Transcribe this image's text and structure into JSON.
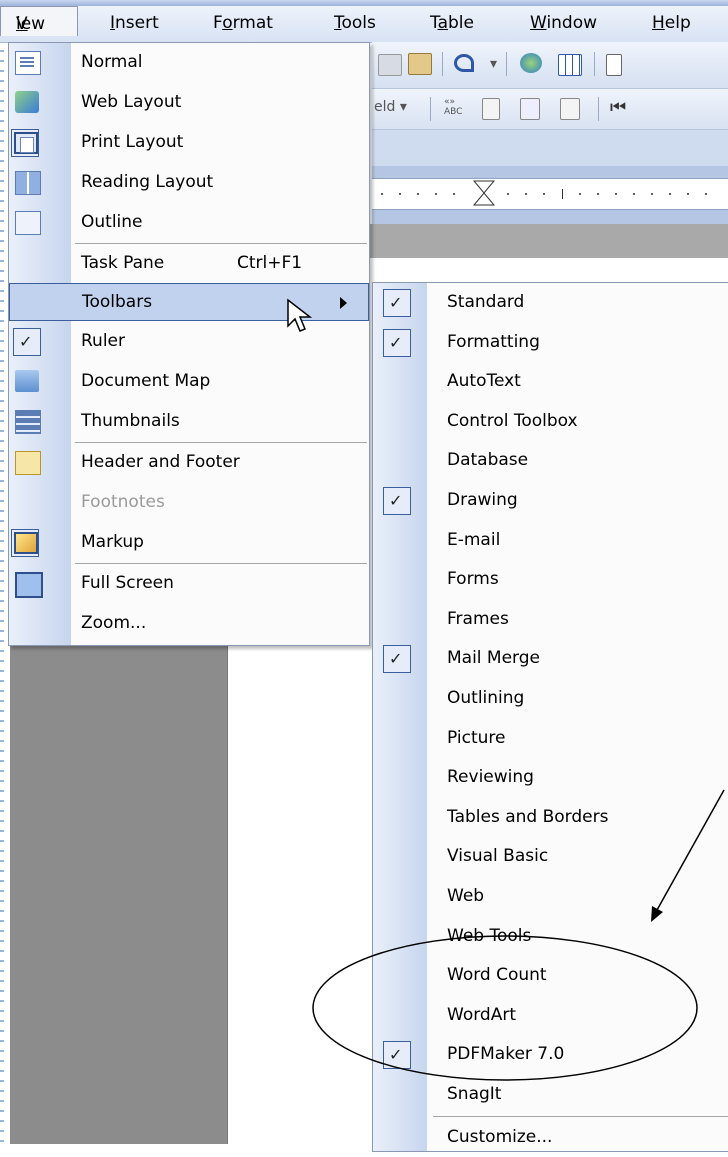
{
  "menubar": {
    "items": [
      "View",
      "Insert",
      "Format",
      "Tools",
      "Table",
      "Window",
      "Help"
    ]
  },
  "toolbar": {
    "field_dropdown": "eld",
    "abc_label": "ABC"
  },
  "view_menu": {
    "items": [
      {
        "label": "Normal",
        "icon": "normal-view-icon"
      },
      {
        "label": "Web Layout",
        "icon": "web-layout-icon"
      },
      {
        "label": "Print Layout",
        "icon": "print-layout-icon",
        "checked": true
      },
      {
        "label": "Reading Layout",
        "icon": "reading-layout-icon"
      },
      {
        "label": "Outline",
        "icon": "outline-icon"
      },
      {
        "label": "Task Pane",
        "shortcut": "Ctrl+F1"
      },
      {
        "label": "Toolbars",
        "submenu": true,
        "highlighted": true
      },
      {
        "label": "Ruler",
        "checked": true
      },
      {
        "label": "Document Map",
        "icon": "document-map-icon"
      },
      {
        "label": "Thumbnails",
        "icon": "thumbnails-icon"
      },
      {
        "label": "Header and Footer",
        "icon": "header-footer-icon"
      },
      {
        "label": "Footnotes",
        "disabled": true
      },
      {
        "label": "Markup",
        "icon": "markup-icon",
        "checked": true
      },
      {
        "label": "Full Screen",
        "icon": "full-screen-icon"
      },
      {
        "label": "Zoom..."
      }
    ]
  },
  "toolbars_menu": {
    "items": [
      {
        "label": "Standard",
        "checked": true
      },
      {
        "label": "Formatting",
        "checked": true
      },
      {
        "label": "AutoText",
        "checked": false
      },
      {
        "label": "Control Toolbox",
        "checked": false
      },
      {
        "label": "Database",
        "checked": false
      },
      {
        "label": "Drawing",
        "checked": true
      },
      {
        "label": "E-mail",
        "checked": false
      },
      {
        "label": "Forms",
        "checked": false
      },
      {
        "label": "Frames",
        "checked": false
      },
      {
        "label": "Mail Merge",
        "checked": true
      },
      {
        "label": "Outlining",
        "checked": false
      },
      {
        "label": "Picture",
        "checked": false
      },
      {
        "label": "Reviewing",
        "checked": false
      },
      {
        "label": "Tables and Borders",
        "checked": false
      },
      {
        "label": "Visual Basic",
        "checked": false
      },
      {
        "label": "Web",
        "checked": false
      },
      {
        "label": "Web Tools",
        "checked": false
      },
      {
        "label": "Word Count",
        "checked": false
      },
      {
        "label": "WordArt",
        "checked": false
      },
      {
        "label": "PDFMaker 7.0",
        "checked": true
      },
      {
        "label": "SnagIt",
        "checked": false
      },
      {
        "label": "Customize..."
      }
    ]
  },
  "colors": {
    "highlight": "#c1d2ee",
    "highlight_border": "#3a5f9c",
    "gutter": "#c6d5ee",
    "disabled_text": "#9a9a9a"
  }
}
